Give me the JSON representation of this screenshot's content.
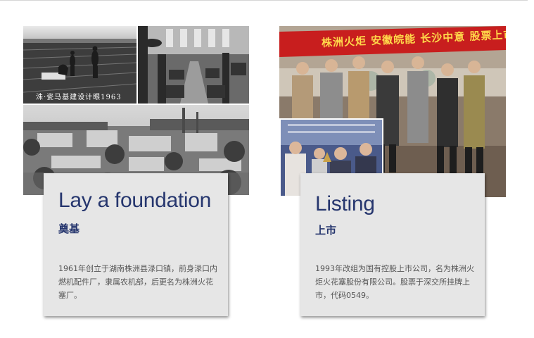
{
  "photos": {
    "left_caption": "洙·瓷马基建设计眼1963",
    "right_banner": "株洲火炬 安徽皖能 长沙中意 股票上市仪式"
  },
  "cards": [
    {
      "title": "Lay a foundation",
      "subtitle": "奠基",
      "description": "1961年创立于湖南株洲县渌口镇，前身渌口内燃机配件厂，隶属农机部，后更名为株洲火花塞厂。"
    },
    {
      "title": "Listing",
      "subtitle": "上市",
      "description": "1993年改组为国有控股上市公司，名为株洲火炬火花塞股份有限公司。股票于深交所挂牌上市，代码0549。"
    }
  ],
  "colors": {
    "title_color": "#26366e",
    "card_bg": "#e6e6e6",
    "desc_color": "#555555",
    "banner_red": "#c81e1e"
  }
}
